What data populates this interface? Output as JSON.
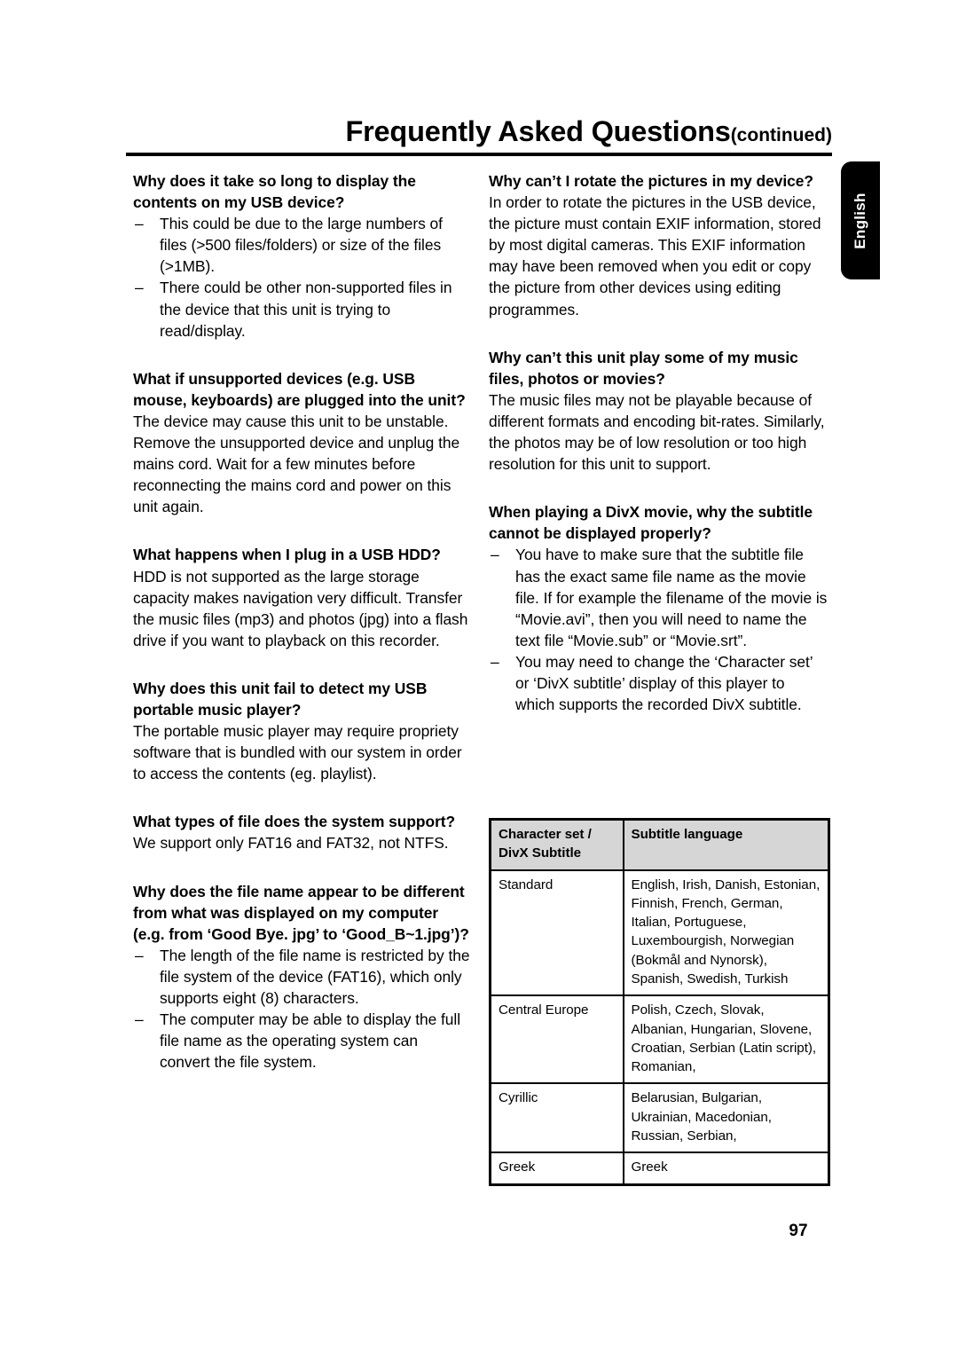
{
  "header": {
    "title": "Frequently Asked Questions",
    "continued": "(continued)"
  },
  "side_tab": {
    "label": "English"
  },
  "page_number": "97",
  "bullet_marker": "–",
  "left_column": [
    {
      "question": "Why does it take so long to display the contents on my USB device?",
      "bullets": [
        "This could be due to the large numbers of files (>500 files/folders) or size of the files (>1MB).",
        "There could be other non-supported files in the device that this unit is trying to read/display."
      ]
    },
    {
      "question": "What if unsupported devices (e.g. USB mouse, keyboards) are plugged into the unit?",
      "answer": "The device may cause this unit to be unstable.  Remove the unsupported device and unplug the mains cord.  Wait for a few minutes before reconnecting the mains cord and power on this unit again."
    },
    {
      "question": "What happens when I plug in a USB HDD?",
      "answer": "HDD is not supported as the large storage capacity makes navigation very difficult. Transfer the music files (mp3) and photos (jpg) into a flash drive if you want to playback on this recorder."
    },
    {
      "question": "Why does this unit fail to detect my USB portable music player?",
      "answer": "The portable music player may require propriety software that is bundled with our system in order to access the contents (eg. playlist)."
    },
    {
      "question": "What types of file does the system support?",
      "answer": "We support only FAT16 and FAT32, not NTFS."
    },
    {
      "question": "Why does the file name appear to be different from what was displayed on my computer (e.g. from ‘Good Bye. jpg’ to ‘Good_B~1.jpg’)?",
      "bullets": [
        "The length of the file name is restricted by the file system of the device (FAT16), which only supports eight (8) characters.",
        "The computer may be able to display the full file name as the operating system can convert the file system."
      ]
    }
  ],
  "right_column": [
    {
      "question": "Why can’t I rotate the pictures in my device?",
      "answer": "In order to rotate the pictures in the USB device, the picture must contain EXIF information, stored by most digital cameras. This EXIF information may have been removed when you edit or copy the picture from other devices using editing programmes."
    },
    {
      "question": "Why can’t this unit play some of my music files, photos or movies?",
      "answer": "The music files may not be playable because of different formats and encoding bit-rates. Similarly, the photos may be of low resolution or too high resolution for this unit to support."
    },
    {
      "question": "When playing a DivX movie, why the subtitle cannot be displayed properly?",
      "bullets": [
        "You have to make sure that the subtitle file has the exact same file name as the movie file. If for example the filename of the movie is “Movie.avi”, then you will need to name the text file “Movie.sub” or “Movie.srt”.",
        "You may need to change the ‘Character set’ or ‘DivX subtitle’ display of this player to which supports the recorded DivX subtitle."
      ]
    }
  ],
  "subtitle_table": {
    "headers": [
      "Character set / DivX Subtitle",
      "Subtitle language"
    ],
    "rows": [
      {
        "charset": "Standard",
        "languages": "English, Irish, Danish, Estonian, Finnish, French, German, Italian, Portuguese, Luxembourgish, Norwegian (Bokmål and Nynorsk), Spanish, Swedish, Turkish"
      },
      {
        "charset": "Central Europe",
        "languages": "Polish, Czech, Slovak, Albanian, Hungarian, Slovene, Croatian, Serbian (Latin script), Romanian,"
      },
      {
        "charset": "Cyrillic",
        "languages": "Belarusian, Bulgarian, Ukrainian, Macedonian, Russian, Serbian,"
      },
      {
        "charset": "Greek",
        "languages": "Greek"
      }
    ]
  }
}
